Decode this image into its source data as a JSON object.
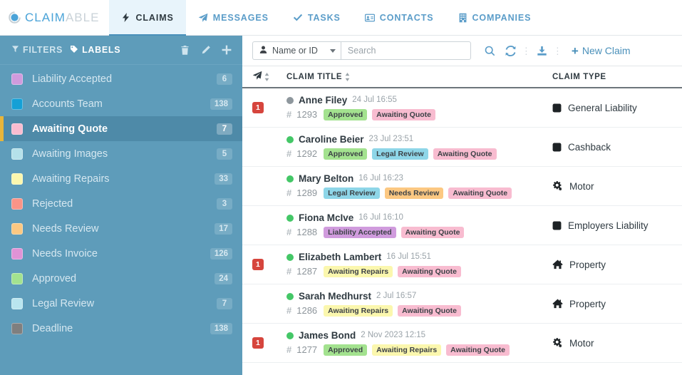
{
  "brand": {
    "name_a": "CLAIM",
    "name_b": "ABLE",
    "logo_icon": "circle-arrow-icon"
  },
  "nav": [
    {
      "label": "CLAIMS",
      "icon": "bolt-icon",
      "active": true
    },
    {
      "label": "MESSAGES",
      "icon": "paper-plane-icon",
      "active": false
    },
    {
      "label": "TASKS",
      "icon": "check-icon",
      "active": false
    },
    {
      "label": "CONTACTS",
      "icon": "id-card-icon",
      "active": false
    },
    {
      "label": "COMPANIES",
      "icon": "building-icon",
      "active": false
    }
  ],
  "sidebar": {
    "tabs": [
      {
        "label": "FILTERS",
        "icon": "filter-icon",
        "active": false
      },
      {
        "label": "LABELS",
        "icon": "tag-icon",
        "active": true
      }
    ],
    "actions": [
      {
        "name": "delete-label-button",
        "icon": "trash-icon"
      },
      {
        "name": "edit-label-button",
        "icon": "pencil-icon"
      },
      {
        "name": "add-label-button",
        "icon": "plus-icon"
      }
    ],
    "items": [
      {
        "label": "Liability Accepted",
        "count": "6",
        "color": "#d09bdd",
        "selected": false
      },
      {
        "label": "Accounts Team",
        "count": "138",
        "color": "#14a0d6",
        "selected": false
      },
      {
        "label": "Awaiting Quote",
        "count": "7",
        "color": "#f8bcd0",
        "selected": true
      },
      {
        "label": "Awaiting Images",
        "count": "5",
        "color": "#b5e1ea",
        "selected": false
      },
      {
        "label": "Awaiting Repairs",
        "count": "33",
        "color": "#fbf7ae",
        "selected": false
      },
      {
        "label": "Rejected",
        "count": "3",
        "color": "#fb9487",
        "selected": false
      },
      {
        "label": "Needs Review",
        "count": "17",
        "color": "#fcc882",
        "selected": false
      },
      {
        "label": "Needs Invoice",
        "count": "126",
        "color": "#e093d6",
        "selected": false
      },
      {
        "label": "Approved",
        "count": "24",
        "color": "#a3e28f",
        "selected": false
      },
      {
        "label": "Legal Review",
        "count": "7",
        "color": "#b9e5ef",
        "selected": false
      },
      {
        "label": "Deadline",
        "count": "138",
        "color": "#7f7f7f",
        "selected": false
      }
    ]
  },
  "toolbar": {
    "filter_select": "Name or ID",
    "filter_select_icon": "person-icon",
    "search_placeholder": "Search",
    "search_value": "",
    "icons": [
      {
        "name": "search-icon",
        "glyph": "search"
      },
      {
        "name": "refresh-icon",
        "glyph": "refresh"
      },
      {
        "name": "download-icon",
        "glyph": "download"
      }
    ],
    "new_claim_label": "New Claim"
  },
  "table": {
    "headers": {
      "flag": "",
      "title": "CLAIM TITLE",
      "type": "CLAIM TYPE"
    },
    "rows": [
      {
        "badge": "1",
        "status_color": "#8e979d",
        "name": "Anne Filey",
        "date": "24 Jul 16:55",
        "id": "1293",
        "tags": [
          {
            "label": "Approved",
            "color": "#a3e28f"
          },
          {
            "label": "Awaiting Quote",
            "color": "#f8bcd0"
          }
        ],
        "type": "General Liability",
        "type_icon": "square-icon"
      },
      {
        "badge": "",
        "status_color": "#44c767",
        "name": "Caroline Beier",
        "date": "23 Jul 23:51",
        "id": "1292",
        "tags": [
          {
            "label": "Approved",
            "color": "#a3e28f"
          },
          {
            "label": "Legal Review",
            "color": "#8ed6e8"
          },
          {
            "label": "Awaiting Quote",
            "color": "#f8bcd0"
          }
        ],
        "type": "Cashback",
        "type_icon": "square-icon"
      },
      {
        "badge": "",
        "status_color": "#44c767",
        "name": "Mary Belton",
        "date": "16 Jul 16:23",
        "id": "1289",
        "tags": [
          {
            "label": "Legal Review",
            "color": "#8ed6e8"
          },
          {
            "label": "Needs Review",
            "color": "#fcc882"
          },
          {
            "label": "Awaiting Quote",
            "color": "#f8bcd0"
          }
        ],
        "type": "Motor",
        "type_icon": "cogs-icon"
      },
      {
        "badge": "",
        "status_color": "#44c767",
        "name": "Fiona McIve",
        "date": "16 Jul 16:10",
        "id": "1288",
        "tags": [
          {
            "label": "Liability Accepted",
            "color": "#d09bdd"
          },
          {
            "label": "Awaiting Quote",
            "color": "#f8bcd0"
          }
        ],
        "type": "Employers Liability",
        "type_icon": "square-icon"
      },
      {
        "badge": "1",
        "status_color": "#44c767",
        "name": "Elizabeth Lambert",
        "date": "16 Jul 15:51",
        "id": "1287",
        "tags": [
          {
            "label": "Awaiting Repairs",
            "color": "#fbf7ae"
          },
          {
            "label": "Awaiting Quote",
            "color": "#f8bcd0"
          }
        ],
        "type": "Property",
        "type_icon": "home-icon"
      },
      {
        "badge": "",
        "status_color": "#44c767",
        "name": "Sarah Medhurst",
        "date": "2 Jul 16:57",
        "id": "1286",
        "tags": [
          {
            "label": "Awaiting Repairs",
            "color": "#fbf7ae"
          },
          {
            "label": "Awaiting Quote",
            "color": "#f8bcd0"
          }
        ],
        "type": "Property",
        "type_icon": "home-icon"
      },
      {
        "badge": "1",
        "status_color": "#44c767",
        "name": "James Bond",
        "date": "2 Nov 2023 12:15",
        "id": "1277",
        "tags": [
          {
            "label": "Approved",
            "color": "#a3e28f"
          },
          {
            "label": "Awaiting Repairs",
            "color": "#fbf7ae"
          },
          {
            "label": "Awaiting Quote",
            "color": "#f8bcd0"
          }
        ],
        "type": "Motor",
        "type_icon": "cogs-icon"
      }
    ]
  }
}
